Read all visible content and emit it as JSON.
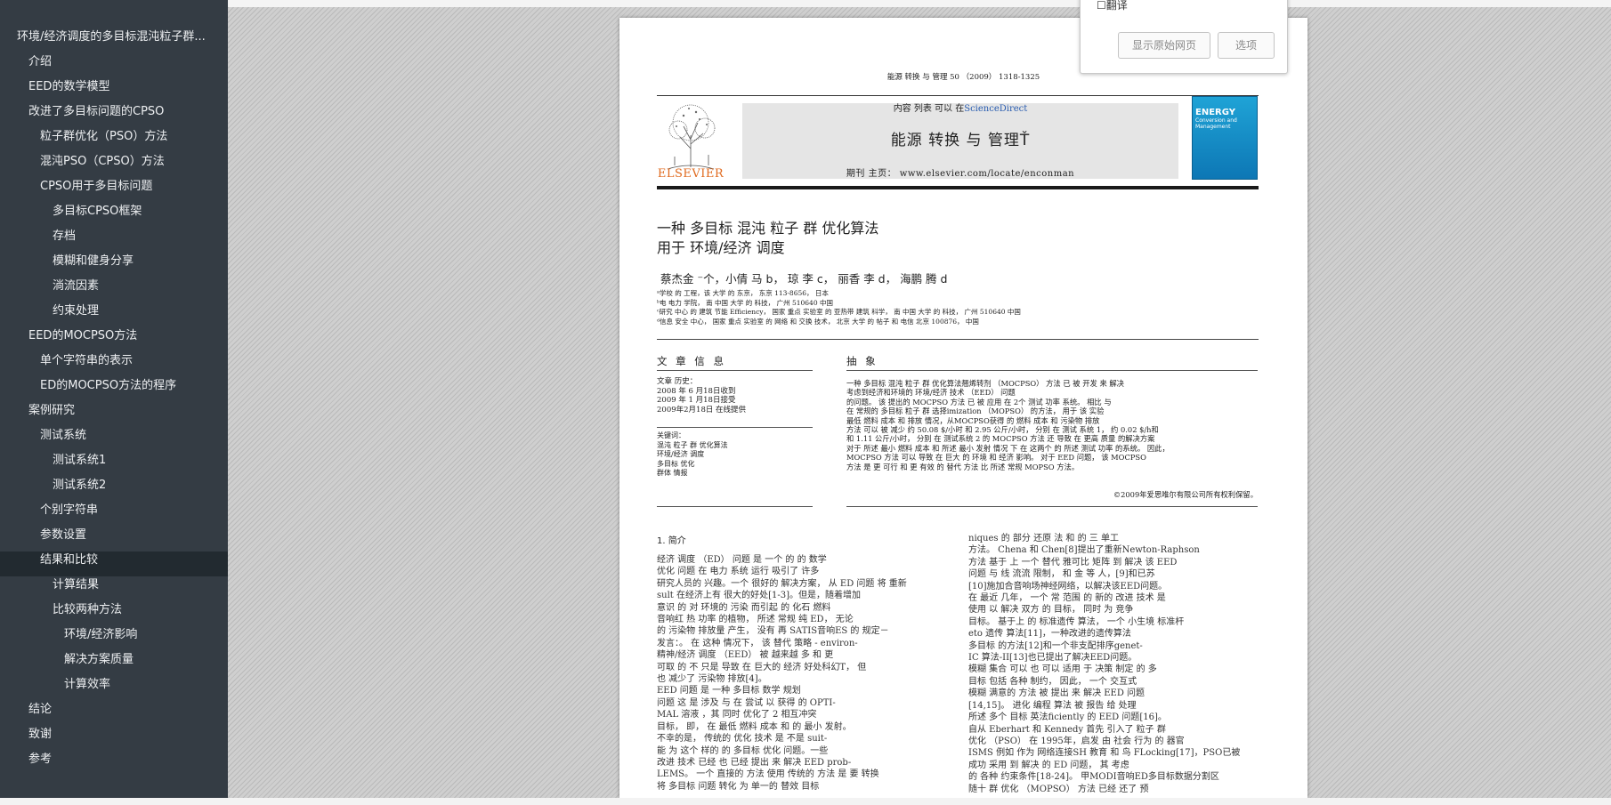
{
  "outline": [
    {
      "label": "环境/经济调度的多目标混沌粒子群...",
      "level": 0
    },
    {
      "label": "介绍",
      "level": 1
    },
    {
      "label": "EED的数学模型",
      "level": 1
    },
    {
      "label": "改进了多目标问题的CPSO",
      "level": 1
    },
    {
      "label": "粒子群优化（PSO）方法",
      "level": 2
    },
    {
      "label": "混沌PSO（CPSO）方法",
      "level": 2
    },
    {
      "label": "CPSO用于多目标问题",
      "level": 2
    },
    {
      "label": "多目标CPSO框架",
      "level": 3
    },
    {
      "label": "存档",
      "level": 3
    },
    {
      "label": "模糊和健身分享",
      "level": 3
    },
    {
      "label": "淌流因素",
      "level": 3
    },
    {
      "label": "约束处理",
      "level": 3
    },
    {
      "label": "EED的MOCPSO方法",
      "level": 1
    },
    {
      "label": "单个字符串的表示",
      "level": 2
    },
    {
      "label": "ED的MOCPSO方法的程序",
      "level": 2
    },
    {
      "label": "案例研究",
      "level": 1
    },
    {
      "label": "测试系统",
      "level": 2
    },
    {
      "label": "测试系统1",
      "level": 3
    },
    {
      "label": "测试系统2",
      "level": 3
    },
    {
      "label": "个别字符串",
      "level": 2
    },
    {
      "label": "参数设置",
      "level": 2
    },
    {
      "label": "结果和比较",
      "level": 2
    },
    {
      "label": "计算结果",
      "level": 3
    },
    {
      "label": "比较两种方法",
      "level": 3
    },
    {
      "label": "环境/经济影响",
      "level": 4
    },
    {
      "label": "解决方案质量",
      "level": 4
    },
    {
      "label": "计算效率",
      "level": 4
    },
    {
      "label": "结论",
      "level": 1
    },
    {
      "label": "致谢",
      "level": 1
    },
    {
      "label": "参考",
      "level": 1
    }
  ],
  "active_outline_index": 21,
  "pdf": {
    "journal_ref": "能源 转换 与 管理 50 （2009） 1318-1325",
    "contents_prefix": "内容 列表 可以 在",
    "contents_link": "ScienceDirect",
    "journal_title": "能源 转换 与 管理Ť",
    "journal_homepage": "期刊 主页：  www.elsevier.com/locate/enconman",
    "publisher": "ELSEVIER",
    "cover_title": "ENERGY",
    "cover_subtitle": "Conversion and Management",
    "title_line1": "一种 多目标 混沌 粒子 群 优化算法",
    "title_line2": "用于 环境/经济 调度",
    "authors": "蔡杰金  ⁻个，小倩 马   b， 琼 李   c， 丽香 李 d， 海鹏 腾        d",
    "affiliations": [
      "ᵃ学校 的 工程，该 大学 的 东京， 东京 113-8656， 日本",
      "ᵇ电 电力 学院， 南 中国 大学 的 科技， 广州 510640 中国",
      "ᶜ研究 中心 的 建筑 节能 Eﬃciency， 国家 重点 实验室 的 亚热带 建筑 科学， 南 中国 大学 的 科技， 广州 510640 中国",
      "ᵈ信息 安全 中心， 国家 重点 实验室 的 网络 和 交换 技术， 北京 大学 的 帖子 和 电信 北京 100876， 中国"
    ],
    "article_info_heading": "文 章  信 息",
    "abstract_heading": "抽 象",
    "history": [
      "文章 历史：",
      "2008 年 6 月18日收到",
      "2009 年 1 月18日接受",
      "2009年2月18日 在线提供"
    ],
    "keywords": [
      "关键词：",
      "混沌 粒子 群 优化算法",
      "环境/经济 调度",
      "多目标 优化",
      "群体 情报"
    ],
    "abstract_lines": [
      "一种 多目标 混沌 粒子 群 优化算法翘烯转剂 （MOCPSO） 方法 已 被 开发 来 解决",
      "考虑到经济和环境的 环境/经济 技术 （EED） 问题",
      "的问题。 该 提出的 MOCPSO 方法 已 被 应用 在 2个 测试 功率 系统。 相比 与",
      "在 常规的 多目标 粒子 群 选择imization （MOPSO） 的方法， 用于 该 实验",
      "最低 燃料 成本 和 排放 情况，从MOCPSO获得 的 燃料 成本 和 污染物 排放",
      "方法 可以 被 减少 约 50.08 $/小时 和 2.95 公斤/小时， 分别 在 测试 系统 1， 约 0.02 $/h和",
      "和 1.11 公斤/小时， 分别 在 测试系统 2 的 MOCPSO 方法 还 导致 在 更高 质量 的解决方案",
      "对于 所述 最小 燃料 成本 和 所述 最小 发射 情况 下 在 这两个 的 所述 测试 功率 的系统。 因此，",
      "MOCPSO 方法 可以 导致 在 巨大 的 环境 和 经济 影响。 对于 EED 问题， 该 MOCPSO",
      "方法 是 更 可行 和 更 有效 的 替代 方法 比 所述 常规 MOPSO 方法。"
    ],
    "copyright": "©2009年爱思唯尔有限公司所有权利保留。",
    "intro_heading": "1. 简介",
    "col_left_lines": [
      "   经济 调度 （ED） 问题 是 一个 的 的 数学",
      "优化 问题 在 电力 系统 运行 吸引了 许多",
      "研究人员的 兴趣。一个 很好的 解决方案， 从 ED 问题 将 重新",
      "sult 在经济上有 很大的好处[1-3]。但是，随着增加",
      "意识 的 对 环境的 污染 而引起 的 化石 燃料",
      "音响红 热 功率 的植物， 所述 常规 纯 ED， 无论",
      "的 污染物 排放量 产生， 没有 再 SATIS音响ES 的 规定－",
      "发言：。 在 这种 情况下， 该 替代 策略 - environ-",
      "精神/经济 调度 （EED） 被 越来越 多 和 更",
      "可取 的 不 只是 导致 在 巨大的 经济 好处科幻T， 但",
      "也 减少了 污染物 排放[4]。",
      "   EED 问题 是 一种 多目标 数学 规划",
      "问题 这 是 涉及 与 在 尝试 以 获得 的 OPTI-",
      "MAL 溶液 ，其 同时 优化了 2 相互冲突",
      "目标， 即， 在 最低 燃料 成本 和 的 最小 发射。",
      "不幸的是， 传统的 优化 技术 是 不是 suit-",
      "能 为 这个 样的 的 多目标 优化 问题。一些",
      "改进 技术 已经 也 已经 提出 来 解决 EED prob-",
      "LEMS。 一个 直接的 方法 使用 传统的 方法 是 要 转换",
      "将 多目标 问题 转化 为 单一的 替效 目标"
    ],
    "col_right_lines": [
      "niques 的 部分 还原 法 和 的 三 单工",
      "方法。 Chena 和 Chen[8]提出了重新Newton-Raphson",
      "方法 基于 上 一个 替代 雅可比 矩阵 到 解决 该 EED",
      "问题 与 线 流流 限制， 和 金 等 人，[9]和已苏",
      "[10]施加合音响场神经网络，以解决该EED问题。",
      "   在 最近 几年， 一个 常 范围 的 新的 改进 技术 是",
      "使用 以 解决 双方 的 目标， 同时 为 竞争",
      "目标。 基于上 的 标准遗传 算法， 一个 小生境 标准杆",
      "eto 遗传 算法[11]，一种改进的遗传算法",
      "多目标 的方法[12]和一个非支配排序genet-",
      "IC 算法-II[13]也已提出了解决EED问题。",
      "模糊 集合 可以 也 可以 适用 于 决策 制定 的 多",
      "目标 包括 各种 制约， 因此， 一个 交互式",
      "模糊 满意的 方法 被 提出 来 解决 EED 问题",
      "[14,15]。 进化 编程 算法 被 报告 给 处理",
      "所述 多个 目标 英法ficiently 的 EED 问题[16]。",
      "   自从 Eberhart 和 Kennedy 首先 引入了 粒子 群",
      "优化 （PSO） 在 1995年，启发 由 社会 行为 的 器官",
      "ISMS 例如 作为 网络连接SH 教育 和 鸟 FLocking[17]，PSO已被",
      "成功 采用 到 解决 的 ED 问题， 其 考虑",
      "的 各种 约束条件[18-24]。 甲MODI音响ED多目标数据分割区",
      "随十 群 优化 （MOPSO） 方法 已经 还了 预"
    ]
  },
  "popup": {
    "checkbox_label": "翻译",
    "show_original_label": "显示原始网页",
    "options_label": "选项"
  }
}
